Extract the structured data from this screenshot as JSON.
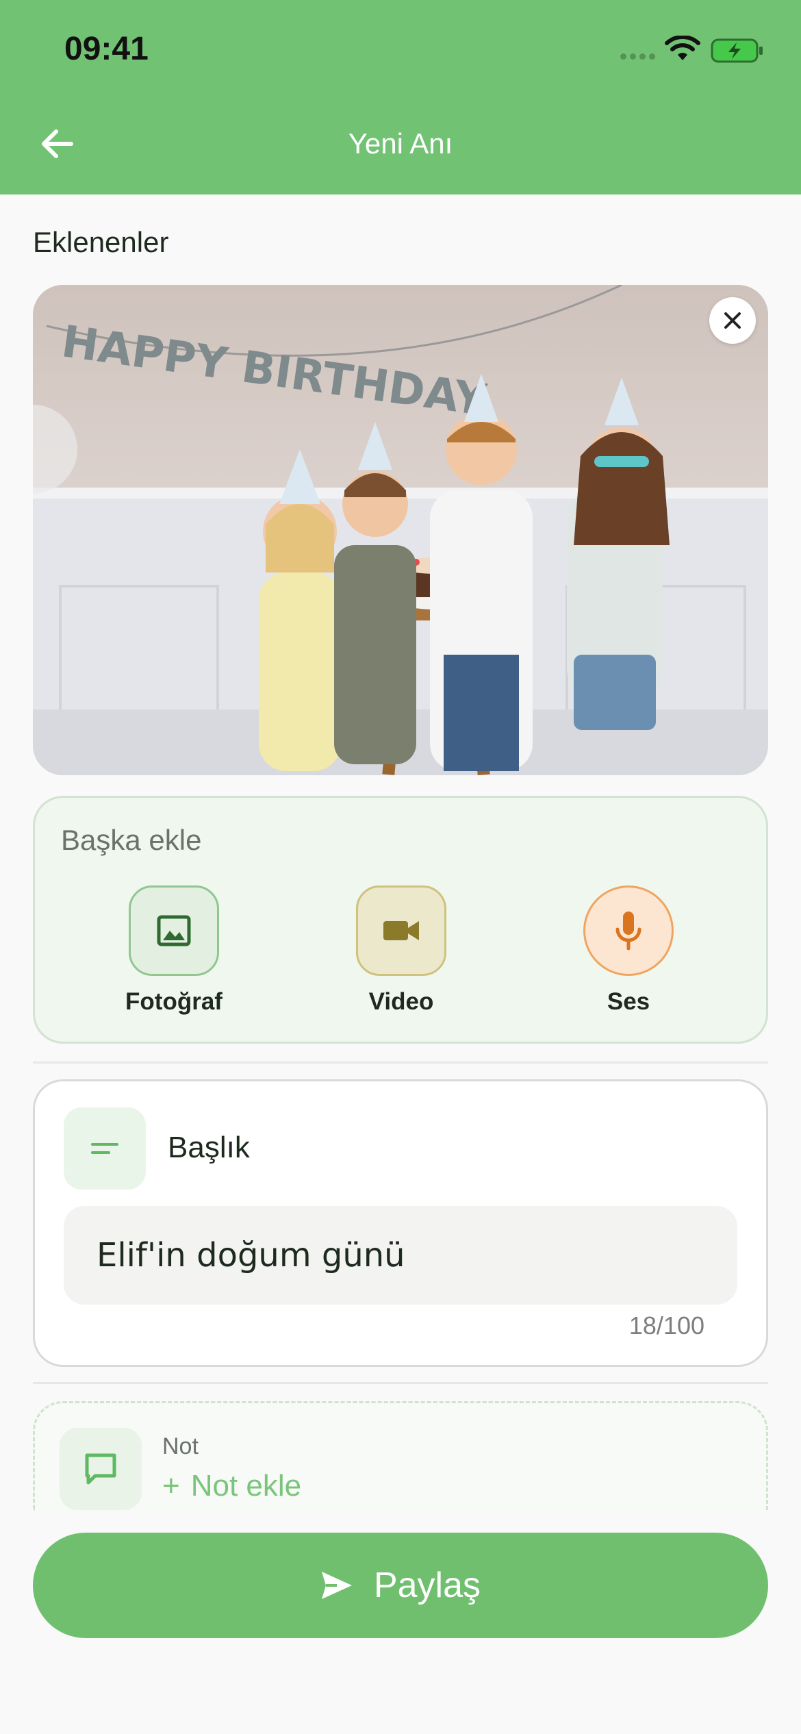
{
  "status_bar": {
    "time": "09:41"
  },
  "header": {
    "title": "Yeni Anı"
  },
  "attachments": {
    "label": "Eklenenler",
    "banner_text": "HAPPY BIRTHDAY"
  },
  "add_more": {
    "title": "Başka ekle",
    "options": [
      {
        "label": "Fotoğraf",
        "icon": "image-icon"
      },
      {
        "label": "Video",
        "icon": "video-icon"
      },
      {
        "label": "Ses",
        "icon": "microphone-icon"
      }
    ]
  },
  "title_field": {
    "label": "Başlık",
    "value": "Elif'in doğum günü",
    "counter": "18/100"
  },
  "note": {
    "label": "Not",
    "add_label": "Not ekle"
  },
  "share_button": {
    "label": "Paylaş"
  },
  "colors": {
    "primary": "#72c274",
    "video_accent": "#8a7a2a",
    "audio_accent": "#d9741f"
  }
}
